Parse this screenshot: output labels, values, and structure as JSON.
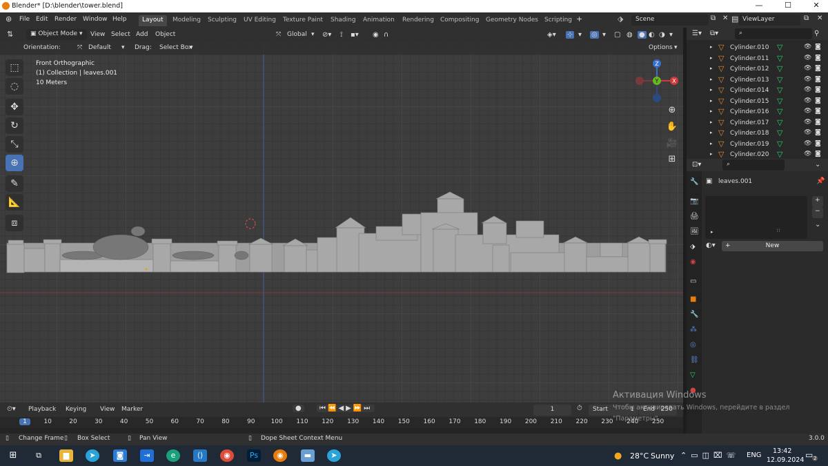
{
  "window": {
    "title": "Blender* [D:\\blender\\tower.blend]",
    "min": "—",
    "max": "☐",
    "close": "✕"
  },
  "menu": {
    "file": "File",
    "edit": "Edit",
    "render": "Render",
    "window": "Window",
    "help": "Help"
  },
  "workspaces": [
    "Layout",
    "Modeling",
    "Sculpting",
    "UV Editing",
    "Texture Paint",
    "Shading",
    "Animation",
    "Rendering",
    "Compositing",
    "Geometry Nodes",
    "Scripting"
  ],
  "workspace_add": "+",
  "scene": {
    "label": "Scene"
  },
  "viewlayer": {
    "label": "ViewLayer"
  },
  "viewport": {
    "mode": "Object Mode",
    "view": "View",
    "select": "Select",
    "add": "Add",
    "object": "Object",
    "transform": "Global",
    "orientation_label": "Orientation:",
    "orientation_value": "Default",
    "drag_label": "Drag:",
    "drag_value": "Select Box",
    "options": "Options",
    "info_view": "Front Orthographic",
    "info_collection": "(1) Collection | leaves.001",
    "info_scale": "10 Meters",
    "gizmo": {
      "z": "Z",
      "y": "Y",
      "x": "X"
    }
  },
  "outliner": {
    "items": [
      "Cylinder.010",
      "Cylinder.011",
      "Cylinder.012",
      "Cylinder.013",
      "Cylinder.014",
      "Cylinder.015",
      "Cylinder.016",
      "Cylinder.017",
      "Cylinder.018",
      "Cylinder.019",
      "Cylinder.020"
    ]
  },
  "properties": {
    "object": "leaves.001",
    "new_button": "New",
    "plus": "+",
    "minus": "−"
  },
  "timeline": {
    "playback": "Playback",
    "keying": "Keying",
    "view": "View",
    "marker": "Marker",
    "current_frame": "1",
    "start_label": "Start",
    "start_value": "1",
    "end_label": "End",
    "end_value": "250",
    "ruler": [
      "1",
      "10",
      "20",
      "30",
      "40",
      "50",
      "60",
      "70",
      "80",
      "90",
      "100",
      "110",
      "120",
      "130",
      "140",
      "150",
      "160",
      "170",
      "180",
      "190",
      "200",
      "210",
      "220",
      "230",
      "240",
      "250"
    ]
  },
  "statusbar": {
    "change_frame": "Change Frame",
    "box_select": "Box Select",
    "pan_view": "Pan View",
    "context_menu": "Dope Sheet Context Menu",
    "version": "3.0.0"
  },
  "watermark": {
    "line1": "Активация Windows",
    "line2": "Чтобы активировать Windows, перейдите в раздел",
    "line3": "\"Параметры\"."
  },
  "taskbar": {
    "temperature": "28°C",
    "weather": "Sunny",
    "language": "ENG",
    "time": "13:42",
    "date": "12.09.2024",
    "notifications": "2"
  }
}
